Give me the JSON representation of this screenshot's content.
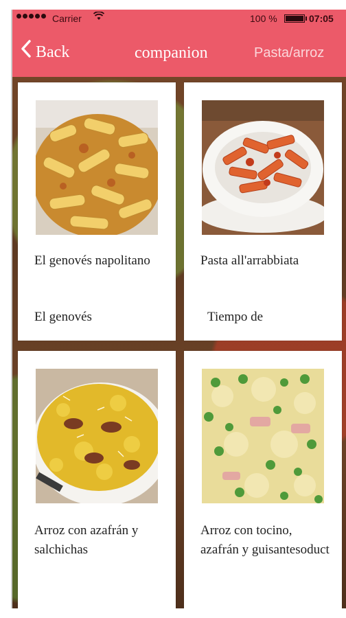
{
  "status_bar": {
    "carrier": "Carrier",
    "battery_percent": "100 %",
    "time": "07:05"
  },
  "nav": {
    "back_label": "Back",
    "title": "companion",
    "right_label": "Pasta/arroz"
  },
  "recipes": [
    {
      "name": "El genovés napolitano",
      "subtitle": "El genovés"
    },
    {
      "name": "Pasta all'arrabbiata",
      "subtitle": "Tiempo de"
    },
    {
      "name": "Arroz con azafrán y salchichas",
      "subtitle": ""
    },
    {
      "name": "Arroz con tocino, azafrán y guisantesoduct",
      "subtitle": ""
    }
  ],
  "colors": {
    "nav_bar": "#ec5a69",
    "card_bg": "#ffffff"
  },
  "icons": [
    "signal-icon",
    "wifi-icon",
    "battery-icon",
    "chevron-left-icon"
  ]
}
